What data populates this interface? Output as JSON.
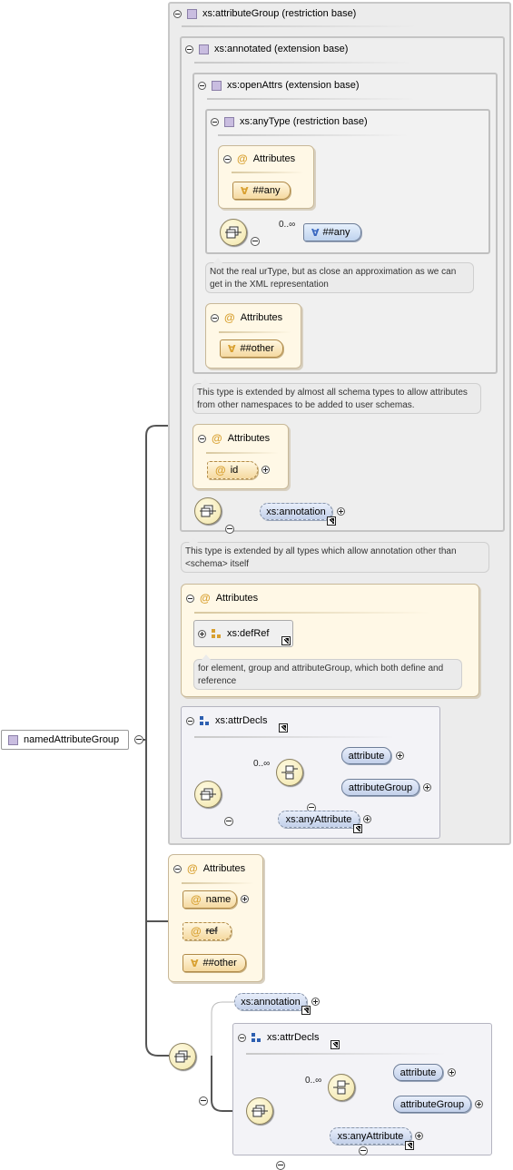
{
  "root": {
    "label": "namedAttributeGroup"
  },
  "attributeGroup_base": {
    "label": "xs:attributeGroup (restriction base)"
  },
  "annotated_base": {
    "label": "xs:annotated (extension base)"
  },
  "openAttrs_base": {
    "label": "xs:openAttrs (extension base)"
  },
  "anyType_base": {
    "label": "xs:anyType (restriction base)",
    "attributes_label": "Attributes",
    "any_attr": "##any",
    "occurs": "0..∞",
    "any_element": "##any",
    "note": "Not the real urType, but as close an approximation as we can get in the XML representation"
  },
  "openAttrs_attributes": {
    "label": "Attributes",
    "other": "##other"
  },
  "openAttrs_note": "This type is extended by almost all schema types to allow attributes from other namespaces to be added to user schemas.",
  "annotated_attributes": {
    "label": "Attributes",
    "id": "id"
  },
  "annotated_annotation": "xs:annotation",
  "annotated_note": "This type is extended by all types which allow annotation other than <schema> itself",
  "defRef_attributes": {
    "label": "Attributes",
    "defRef": "xs:defRef",
    "note": "for element, group and attributeGroup, which both define and reference"
  },
  "attrDecls_1": {
    "label": "xs:attrDecls",
    "occurs": "0..∞",
    "attribute": "attribute",
    "attributeGroup": "attributeGroup",
    "anyAttribute": "xs:anyAttribute"
  },
  "named_attributes": {
    "label": "Attributes",
    "name": "name",
    "ref": "ref",
    "other": "##other"
  },
  "bottom": {
    "annotation": "xs:annotation"
  },
  "attrDecls_2": {
    "label": "xs:attrDecls",
    "occurs": "0..∞",
    "attribute": "attribute",
    "attributeGroup": "attributeGroup",
    "anyAttribute": "xs:anyAttribute"
  },
  "colors": {
    "attribute": "#f5d9a0",
    "element": "#c2d0ea",
    "compositor": "#f2e6a8",
    "type": "#c9bde0"
  }
}
